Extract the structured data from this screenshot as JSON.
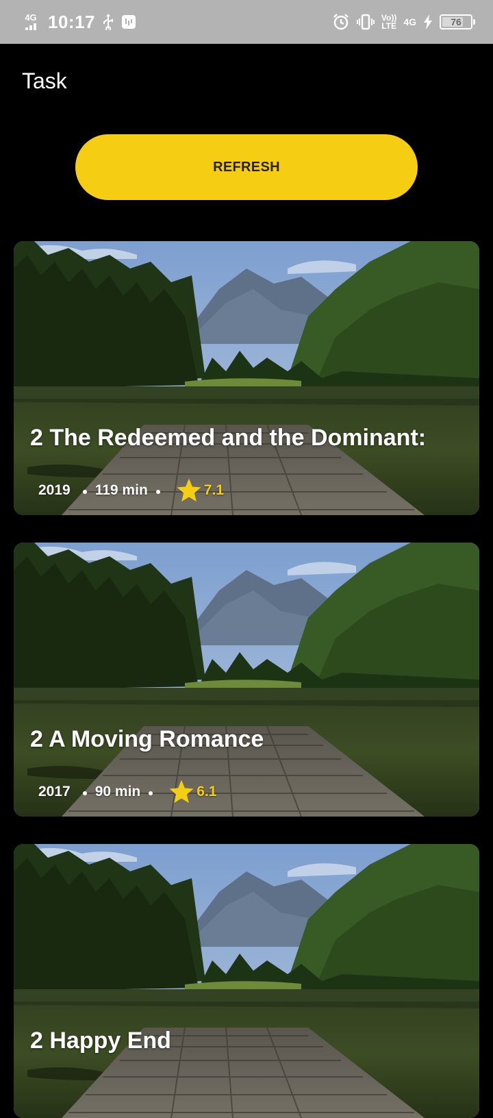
{
  "status_bar": {
    "network": "4G",
    "time": "10:17",
    "volte_top": "Vo))",
    "volte_bottom": "LTE",
    "network_2": "4G",
    "battery": "76",
    "battery_level_percent": 76
  },
  "app": {
    "title": "Task",
    "refresh_label": "REFRESH"
  },
  "theme": {
    "accent": "#f5cd12",
    "background": "#000000"
  },
  "movies": [
    {
      "title": "2 The Redeemed and the Dominant:",
      "year": "2019",
      "duration": "119 min",
      "rating": "7.1"
    },
    {
      "title": "2 A Moving Romance",
      "year": "2017",
      "duration": "90 min",
      "rating": "6.1"
    },
    {
      "title": "2 Happy End",
      "year": "",
      "duration": "",
      "rating": ""
    }
  ]
}
